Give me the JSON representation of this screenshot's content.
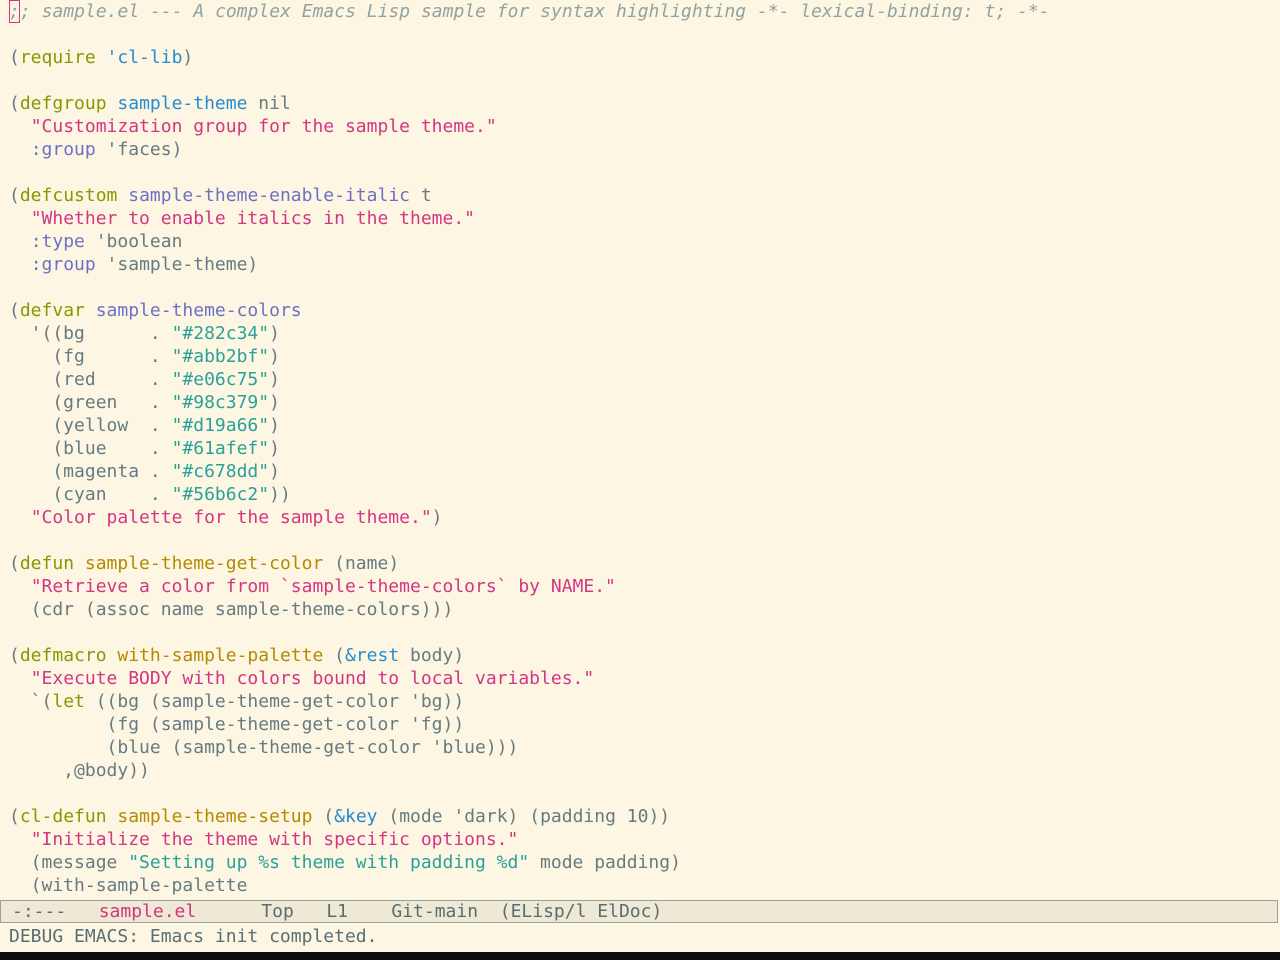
{
  "app": "Emacs",
  "colors": {
    "background": "#fdf6e3",
    "comment": "#93a1a1",
    "keyword": "#859900",
    "quote": "#268bd2",
    "string": "#d33682",
    "literal": "#2aa198",
    "variable_name": "#6c71c4",
    "function_name": "#b58900",
    "default": "#657b83"
  },
  "editor": {
    "lines": [
      [
        {
          "t": ";",
          "c": "comment cursor"
        },
        {
          "t": "; sample.el --- A complex Emacs Lisp sample for syntax highlighting -*- lexical-binding: t; -*-",
          "c": "comment"
        }
      ],
      [],
      [
        {
          "t": "(",
          "c": "plain"
        },
        {
          "t": "require",
          "c": "kw"
        },
        {
          "t": " ",
          "c": "plain"
        },
        {
          "t": "'cl-lib",
          "c": "quote"
        },
        {
          "t": ")",
          "c": "plain"
        }
      ],
      [],
      [
        {
          "t": "(",
          "c": "plain"
        },
        {
          "t": "defgroup",
          "c": "kw"
        },
        {
          "t": " ",
          "c": "plain"
        },
        {
          "t": "sample-theme",
          "c": "quote"
        },
        {
          "t": " nil",
          "c": "plain"
        }
      ],
      [
        {
          "t": "  ",
          "c": "plain"
        },
        {
          "t": "\"Customization group for the sample theme.\"",
          "c": "str"
        }
      ],
      [
        {
          "t": "  ",
          "c": "plain"
        },
        {
          "t": ":group",
          "c": "vname"
        },
        {
          "t": " 'faces)",
          "c": "plain"
        }
      ],
      [],
      [
        {
          "t": "(",
          "c": "plain"
        },
        {
          "t": "defcustom",
          "c": "kw"
        },
        {
          "t": " ",
          "c": "plain"
        },
        {
          "t": "sample-theme-enable-italic",
          "c": "vname"
        },
        {
          "t": " t",
          "c": "plain"
        }
      ],
      [
        {
          "t": "  ",
          "c": "plain"
        },
        {
          "t": "\"Whether to enable italics in the theme.\"",
          "c": "str"
        }
      ],
      [
        {
          "t": "  ",
          "c": "plain"
        },
        {
          "t": ":type",
          "c": "vname"
        },
        {
          "t": " 'boolean",
          "c": "plain"
        }
      ],
      [
        {
          "t": "  ",
          "c": "plain"
        },
        {
          "t": ":group",
          "c": "vname"
        },
        {
          "t": " 'sample-theme)",
          "c": "plain"
        }
      ],
      [],
      [
        {
          "t": "(",
          "c": "plain"
        },
        {
          "t": "defvar",
          "c": "kw"
        },
        {
          "t": " ",
          "c": "plain"
        },
        {
          "t": "sample-theme-colors",
          "c": "vname"
        }
      ],
      [
        {
          "t": "  '((bg      . ",
          "c": "plain"
        },
        {
          "t": "\"#282c34\"",
          "c": "lit"
        },
        {
          "t": ")",
          "c": "plain"
        }
      ],
      [
        {
          "t": "    (fg      . ",
          "c": "plain"
        },
        {
          "t": "\"#abb2bf\"",
          "c": "lit"
        },
        {
          "t": ")",
          "c": "plain"
        }
      ],
      [
        {
          "t": "    (red     . ",
          "c": "plain"
        },
        {
          "t": "\"#e06c75\"",
          "c": "lit"
        },
        {
          "t": ")",
          "c": "plain"
        }
      ],
      [
        {
          "t": "    (green   . ",
          "c": "plain"
        },
        {
          "t": "\"#98c379\"",
          "c": "lit"
        },
        {
          "t": ")",
          "c": "plain"
        }
      ],
      [
        {
          "t": "    (yellow  . ",
          "c": "plain"
        },
        {
          "t": "\"#d19a66\"",
          "c": "lit"
        },
        {
          "t": ")",
          "c": "plain"
        }
      ],
      [
        {
          "t": "    (blue    . ",
          "c": "plain"
        },
        {
          "t": "\"#61afef\"",
          "c": "lit"
        },
        {
          "t": ")",
          "c": "plain"
        }
      ],
      [
        {
          "t": "    (magenta . ",
          "c": "plain"
        },
        {
          "t": "\"#c678dd\"",
          "c": "lit"
        },
        {
          "t": ")",
          "c": "plain"
        }
      ],
      [
        {
          "t": "    (cyan    . ",
          "c": "plain"
        },
        {
          "t": "\"#56b6c2\"",
          "c": "lit"
        },
        {
          "t": "))",
          "c": "plain"
        }
      ],
      [
        {
          "t": "  ",
          "c": "plain"
        },
        {
          "t": "\"Color palette for the sample theme.\"",
          "c": "str"
        },
        {
          "t": ")",
          "c": "plain"
        }
      ],
      [],
      [
        {
          "t": "(",
          "c": "plain"
        },
        {
          "t": "defun",
          "c": "kw"
        },
        {
          "t": " ",
          "c": "plain"
        },
        {
          "t": "sample-theme-get-color",
          "c": "fname"
        },
        {
          "t": " (name)",
          "c": "plain"
        }
      ],
      [
        {
          "t": "  ",
          "c": "plain"
        },
        {
          "t": "\"Retrieve a color from `sample-theme-colors` by NAME.\"",
          "c": "str"
        }
      ],
      [
        {
          "t": "  (cdr (assoc name sample-theme-colors)))",
          "c": "plain"
        }
      ],
      [],
      [
        {
          "t": "(",
          "c": "plain"
        },
        {
          "t": "defmacro",
          "c": "kw"
        },
        {
          "t": " ",
          "c": "plain"
        },
        {
          "t": "with-sample-palette",
          "c": "fname"
        },
        {
          "t": " (",
          "c": "plain"
        },
        {
          "t": "&rest",
          "c": "quote"
        },
        {
          "t": " body)",
          "c": "plain"
        }
      ],
      [
        {
          "t": "  ",
          "c": "plain"
        },
        {
          "t": "\"Execute BODY with colors bound to local variables.\"",
          "c": "str"
        }
      ],
      [
        {
          "t": "  `(",
          "c": "plain"
        },
        {
          "t": "let",
          "c": "kw"
        },
        {
          "t": " ((bg (sample-theme-get-color 'bg))",
          "c": "plain"
        }
      ],
      [
        {
          "t": "         (fg (sample-theme-get-color 'fg))",
          "c": "plain"
        }
      ],
      [
        {
          "t": "         (blue (sample-theme-get-color 'blue)))",
          "c": "plain"
        }
      ],
      [
        {
          "t": "     ,@body))",
          "c": "plain"
        }
      ],
      [],
      [
        {
          "t": "(",
          "c": "plain"
        },
        {
          "t": "cl-defun",
          "c": "kw"
        },
        {
          "t": " ",
          "c": "plain"
        },
        {
          "t": "sample-theme-setup",
          "c": "fname"
        },
        {
          "t": " (",
          "c": "plain"
        },
        {
          "t": "&key",
          "c": "quote"
        },
        {
          "t": " (mode 'dark) (padding 10))",
          "c": "plain"
        }
      ],
      [
        {
          "t": "  ",
          "c": "plain"
        },
        {
          "t": "\"Initialize the theme with specific options.\"",
          "c": "str"
        }
      ],
      [
        {
          "t": "  (message ",
          "c": "plain"
        },
        {
          "t": "\"Setting up %s theme with padding %d\"",
          "c": "lit"
        },
        {
          "t": " mode padding)",
          "c": "plain"
        }
      ],
      [
        {
          "t": "  (with-sample-palette",
          "c": "plain"
        }
      ]
    ]
  },
  "modeline": {
    "status": "-:---",
    "buffer_name": "sample.el",
    "position": "Top",
    "line": "L1",
    "vc": "Git-main",
    "modes": "(ELisp/l ElDoc)"
  },
  "echo_area": {
    "message": "DEBUG EMACS: Emacs init completed."
  }
}
